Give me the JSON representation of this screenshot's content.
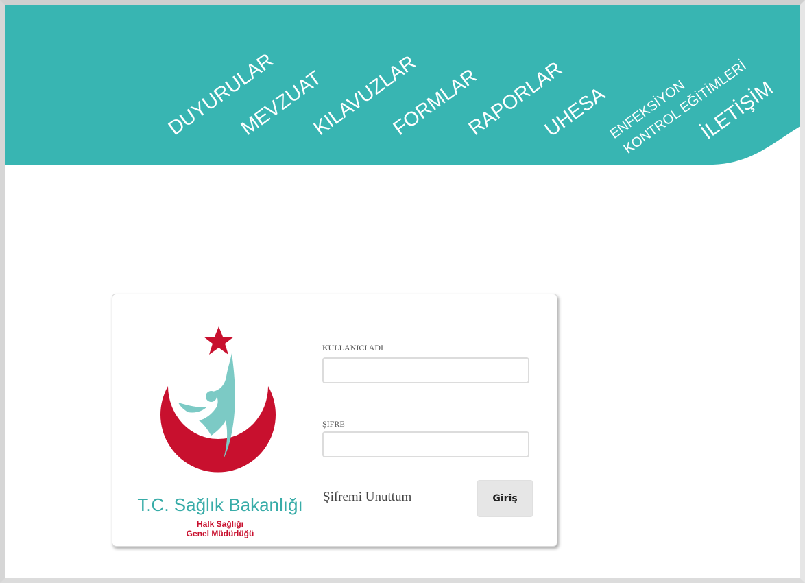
{
  "colors": {
    "banner": "#38b5b2",
    "crescent": "#c8102e",
    "star": "#c8102e",
    "figure": "#7ccac5",
    "brand_text": "#38aca8",
    "sub_text": "#c8102e"
  },
  "nav": {
    "items": [
      {
        "label": "DUYURULAR"
      },
      {
        "label": "MEVZUAT"
      },
      {
        "label": "KILAVUZLAR"
      },
      {
        "label": "FORMLAR"
      },
      {
        "label": "RAPORLAR"
      },
      {
        "label": "UHESA"
      },
      {
        "label_line1": "ENFEKSİYON",
        "label_line2": "KONTROL EĞİTİMLERİ"
      },
      {
        "label": "İLETİŞİM"
      }
    ]
  },
  "logo": {
    "brand": "T.C. Sağlık Bakanlığı",
    "sub_line1": "Halk Sağlığı",
    "sub_line2": "Genel Müdürlüğü",
    "icons": [
      "star-icon",
      "crescent-icon",
      "human-figure-icon"
    ]
  },
  "login": {
    "username_label": "KULLANICI ADI",
    "username_value": "",
    "password_label": "ŞIFRE",
    "password_value": "",
    "forgot_label": "Şifremi Unuttum",
    "submit_label": "Giriş"
  }
}
